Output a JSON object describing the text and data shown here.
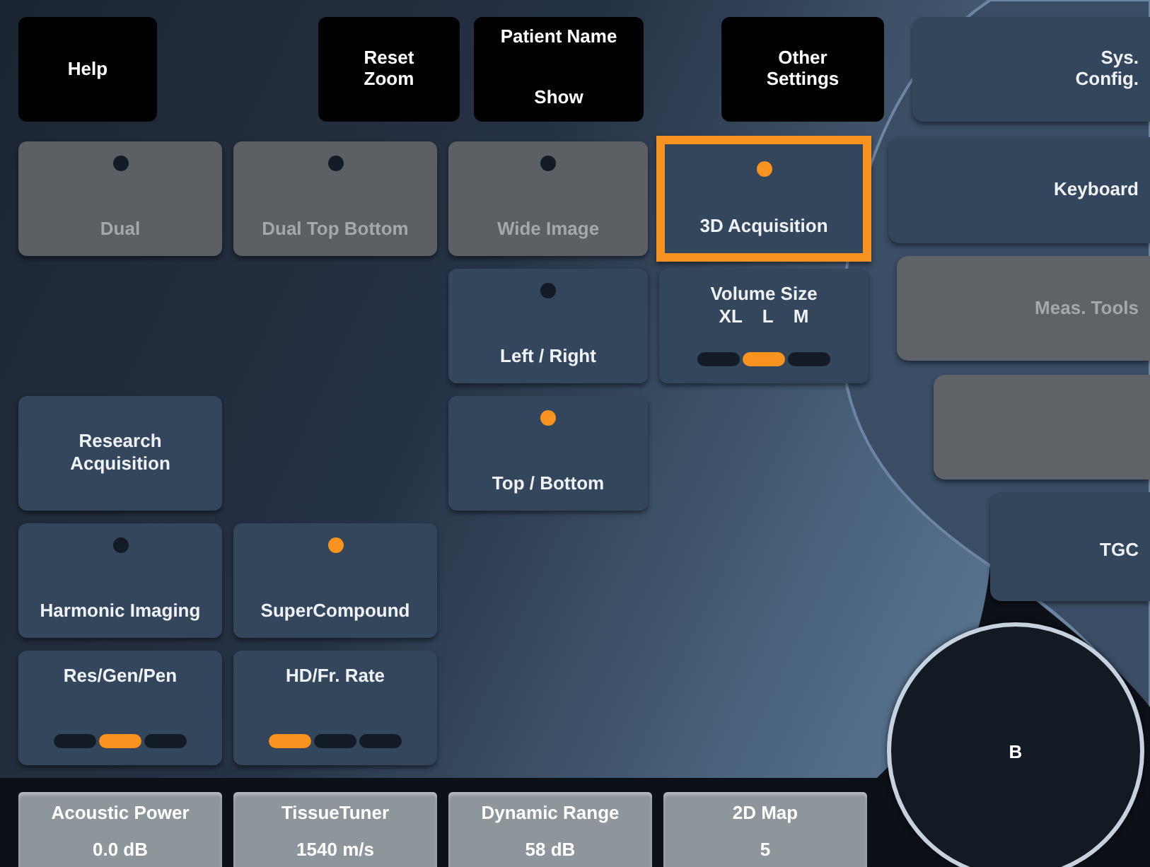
{
  "top_buttons": [
    {
      "label": "Help"
    },
    {
      "label": "Reset Zoom"
    },
    {
      "label": "Patient Name",
      "value": "Show"
    },
    {
      "label": "Other Settings"
    }
  ],
  "mode_buttons": [
    {
      "kind": "toggle",
      "label": "Dual",
      "on": false,
      "disabled": true,
      "focused": false
    },
    {
      "kind": "toggle",
      "label": "Dual Top Bottom",
      "on": false,
      "disabled": true,
      "focused": false
    },
    {
      "kind": "toggle",
      "label": "Wide Image",
      "on": false,
      "disabled": true,
      "focused": false
    },
    {
      "kind": "toggle",
      "label": "3D Acquisition",
      "on": true,
      "disabled": false,
      "focused": true
    },
    {
      "kind": "toggle",
      "label": "Left / Right",
      "on": false,
      "disabled": false,
      "focused": false
    },
    {
      "kind": "selector",
      "label": "Volume Size",
      "options": [
        "XL",
        "L",
        "M"
      ],
      "segments": [
        {
          "selected": false
        },
        {
          "selected": true
        },
        {
          "selected": false
        }
      ]
    },
    {
      "kind": "plain",
      "label": "Research Acquisition"
    },
    {
      "kind": "toggle",
      "label": "Top / Bottom",
      "on": true,
      "disabled": false,
      "focused": false
    },
    {
      "kind": "toggle",
      "label": "Harmonic Imaging",
      "on": false,
      "disabled": false,
      "focused": false
    },
    {
      "kind": "toggle",
      "label": "SuperCompound",
      "on": true,
      "disabled": false,
      "focused": false
    },
    {
      "kind": "selector",
      "label": "Res/Gen/Pen",
      "segments": [
        {
          "selected": false
        },
        {
          "selected": true
        },
        {
          "selected": false
        }
      ]
    },
    {
      "kind": "selector",
      "label": "HD/Fr. Rate",
      "segments": [
        {
          "selected": true
        },
        {
          "selected": false
        },
        {
          "selected": false
        }
      ]
    }
  ],
  "side_buttons": [
    {
      "label": "Sys. Config.",
      "disabled": false
    },
    {
      "label": "Keyboard",
      "disabled": false
    },
    {
      "label": "Meas. Tools",
      "disabled": true
    },
    {
      "disabled": true
    },
    {
      "label": "TGC",
      "disabled": false
    }
  ],
  "mode_knob": {
    "label": "B"
  },
  "parameters": [
    {
      "name": "Acoustic Power",
      "value": "0.0 dB"
    },
    {
      "name": "TissueTuner",
      "value": "1540 m/s"
    },
    {
      "name": "Dynamic Range",
      "value": "58 dB"
    },
    {
      "name": "2D Map",
      "value": "5"
    }
  ]
}
